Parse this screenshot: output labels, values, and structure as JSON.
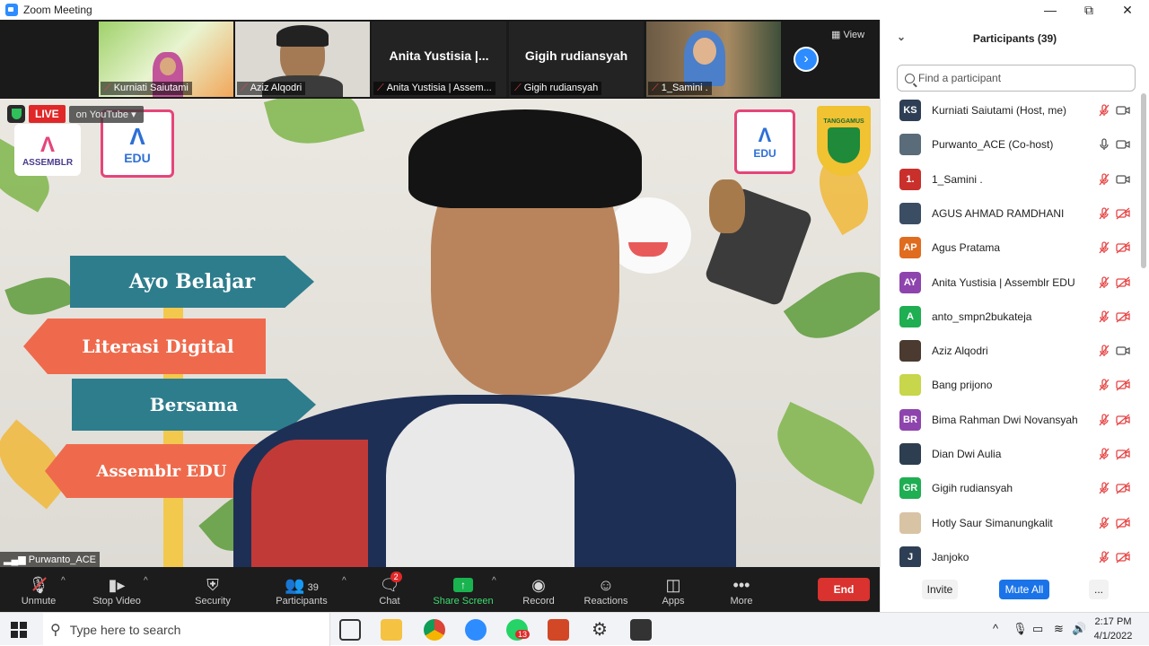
{
  "window": {
    "title": "Zoom Meeting",
    "controls": [
      "minimize-icon",
      "restore-icon",
      "close-icon"
    ]
  },
  "thumbnails": [
    {
      "label": "Kurniati Saiutami",
      "kind": "video"
    },
    {
      "label": "Aziz Alqodri",
      "kind": "video"
    },
    {
      "label": "Anita Yustisia | Assem...",
      "display_name": "Anita Yustisia |...",
      "kind": "name"
    },
    {
      "label": "Gigih rudiansyah",
      "display_name": "Gigih rudiansyah",
      "kind": "name"
    },
    {
      "label": "1_Samini .",
      "kind": "video"
    }
  ],
  "view_button": "View",
  "main": {
    "live_label": "LIVE",
    "stream_target": "on YouTube",
    "speaker_name": "Purwanto_ACE",
    "signs": [
      "Ayo Belajar",
      "Literasi Digital",
      "Bersama",
      "Assemblr EDU"
    ],
    "logos": [
      "ASSEMBLR",
      "EDU",
      "EDU",
      "TANGGAMUS"
    ]
  },
  "toolbar": {
    "unmute": "Unmute",
    "stop_video": "Stop Video",
    "security": "Security",
    "participants": "Participants",
    "participants_count": "39",
    "chat": "Chat",
    "chat_badge": "2",
    "share_screen": "Share Screen",
    "record": "Record",
    "reactions": "Reactions",
    "apps": "Apps",
    "more": "More",
    "end": "End"
  },
  "panel": {
    "title": "Participants (39)",
    "search_placeholder": "Find a participant",
    "participants": [
      {
        "name": "Kurniati Saiutami (Host, me)",
        "initials": "KS",
        "color": "#2e3f55",
        "mic": "muted",
        "cam": "on"
      },
      {
        "name": "Purwanto_ACE (Co-host)",
        "initials": "",
        "color": "#5a6b7a",
        "mic": "on",
        "cam": "on"
      },
      {
        "name": "1_Samini .",
        "initials": "1.",
        "color": "#c9302c",
        "mic": "muted",
        "cam": "on"
      },
      {
        "name": "AGUS AHMAD RAMDHANI",
        "initials": "",
        "color": "#3b4d63",
        "mic": "muted",
        "cam": "off"
      },
      {
        "name": "Agus Pratama",
        "initials": "AP",
        "color": "#e06c1f",
        "mic": "muted",
        "cam": "off"
      },
      {
        "name": "Anita Yustisia | Assemblr EDU",
        "initials": "AY",
        "color": "#8e44ad",
        "mic": "muted",
        "cam": "off"
      },
      {
        "name": "anto_smpn2bukateja",
        "initials": "A",
        "color": "#1fae52",
        "mic": "muted",
        "cam": "off"
      },
      {
        "name": "Aziz Alqodri",
        "initials": "",
        "color": "#4a3a30",
        "mic": "muted",
        "cam": "on"
      },
      {
        "name": "Bang prijono",
        "initials": "",
        "color": "#c7d64a",
        "mic": "muted",
        "cam": "off"
      },
      {
        "name": "Bima Rahman Dwi Novansyah",
        "initials": "BR",
        "color": "#8e44ad",
        "mic": "muted",
        "cam": "off"
      },
      {
        "name": "Dian Dwi Aulia",
        "initials": "",
        "color": "#2c3e50",
        "mic": "muted",
        "cam": "off"
      },
      {
        "name": "Gigih rudiansyah",
        "initials": "GR",
        "color": "#1fae52",
        "mic": "muted",
        "cam": "off"
      },
      {
        "name": "Hotly Saur Simanungkalit",
        "initials": "",
        "color": "#d9c3a5",
        "mic": "muted",
        "cam": "off"
      },
      {
        "name": "Janjoko",
        "initials": "J",
        "color": "#2e3f55",
        "mic": "muted",
        "cam": "off"
      }
    ],
    "invite": "Invite",
    "mute_all": "Mute All",
    "more": "..."
  },
  "taskbar": {
    "search_placeholder": "Type here to search",
    "whatsapp_badge": "13",
    "time": "2:17 PM",
    "date": "4/1/2022"
  },
  "colors": {
    "zoom_blue": "#2d8cff",
    "end_red": "#d9322f",
    "muted_red": "#e64545",
    "share_green": "#19b34f"
  }
}
